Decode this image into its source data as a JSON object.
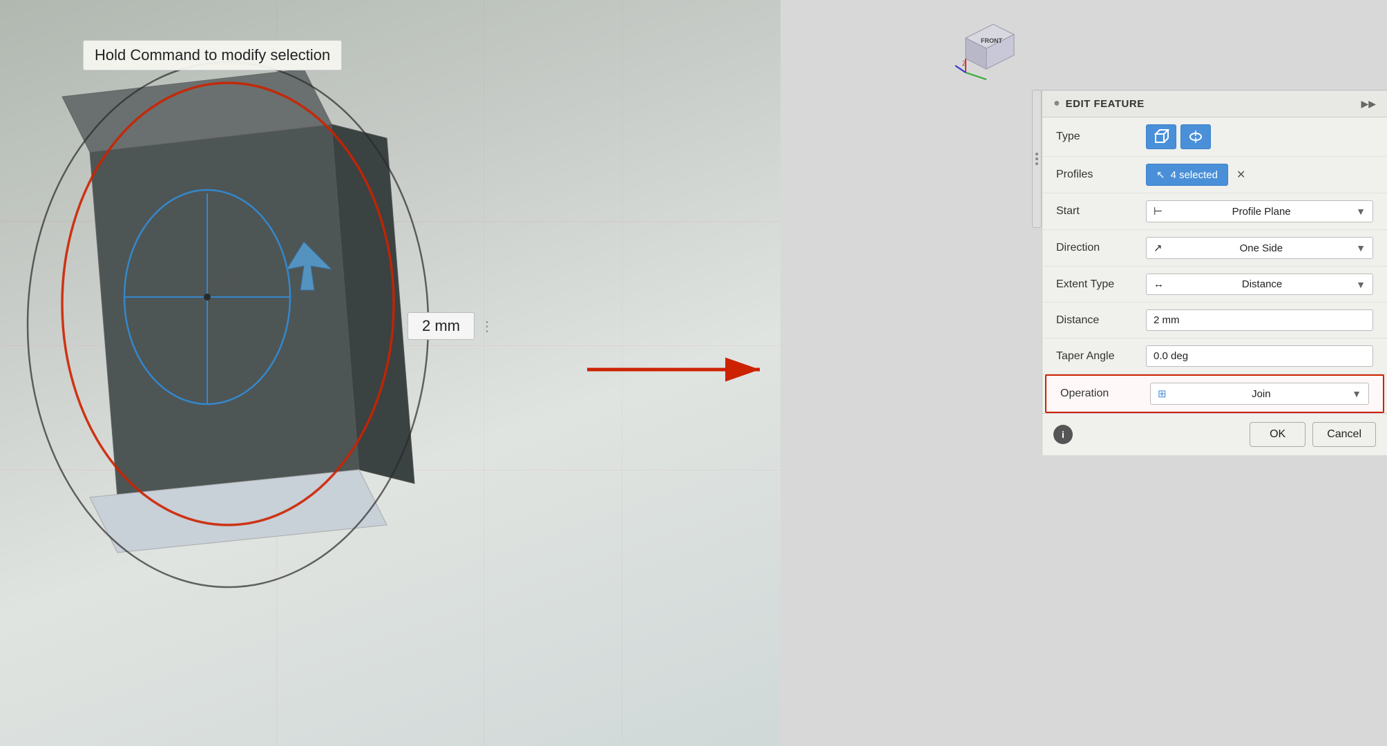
{
  "tooltip": {
    "text": "Hold Command to modify selection"
  },
  "viewport": {
    "dimension": "2 mm",
    "dimension_badge": "2 mm"
  },
  "panel": {
    "header": {
      "title": "EDIT FEATURE",
      "icon": "●",
      "expand_icon": "▶▶"
    },
    "rows": [
      {
        "label": "Type",
        "type": "type-buttons"
      },
      {
        "label": "Profiles",
        "type": "profiles",
        "value": "4 selected"
      },
      {
        "label": "Start",
        "type": "dropdown",
        "icon": "⊢",
        "value": "Profile Plane"
      },
      {
        "label": "Direction",
        "type": "dropdown",
        "icon": "↗",
        "value": "One Side"
      },
      {
        "label": "Extent Type",
        "type": "dropdown",
        "icon": "↔",
        "value": "Distance"
      },
      {
        "label": "Distance",
        "type": "text",
        "value": "2 mm"
      },
      {
        "label": "Taper Angle",
        "type": "text",
        "value": "0.0 deg"
      },
      {
        "label": "Operation",
        "type": "dropdown",
        "icon": "⊞",
        "value": "Join",
        "highlighted": true
      }
    ],
    "footer": {
      "ok": "OK",
      "cancel": "Cancel",
      "info_icon": "i"
    }
  },
  "navcube": {
    "label": "FRONT"
  }
}
